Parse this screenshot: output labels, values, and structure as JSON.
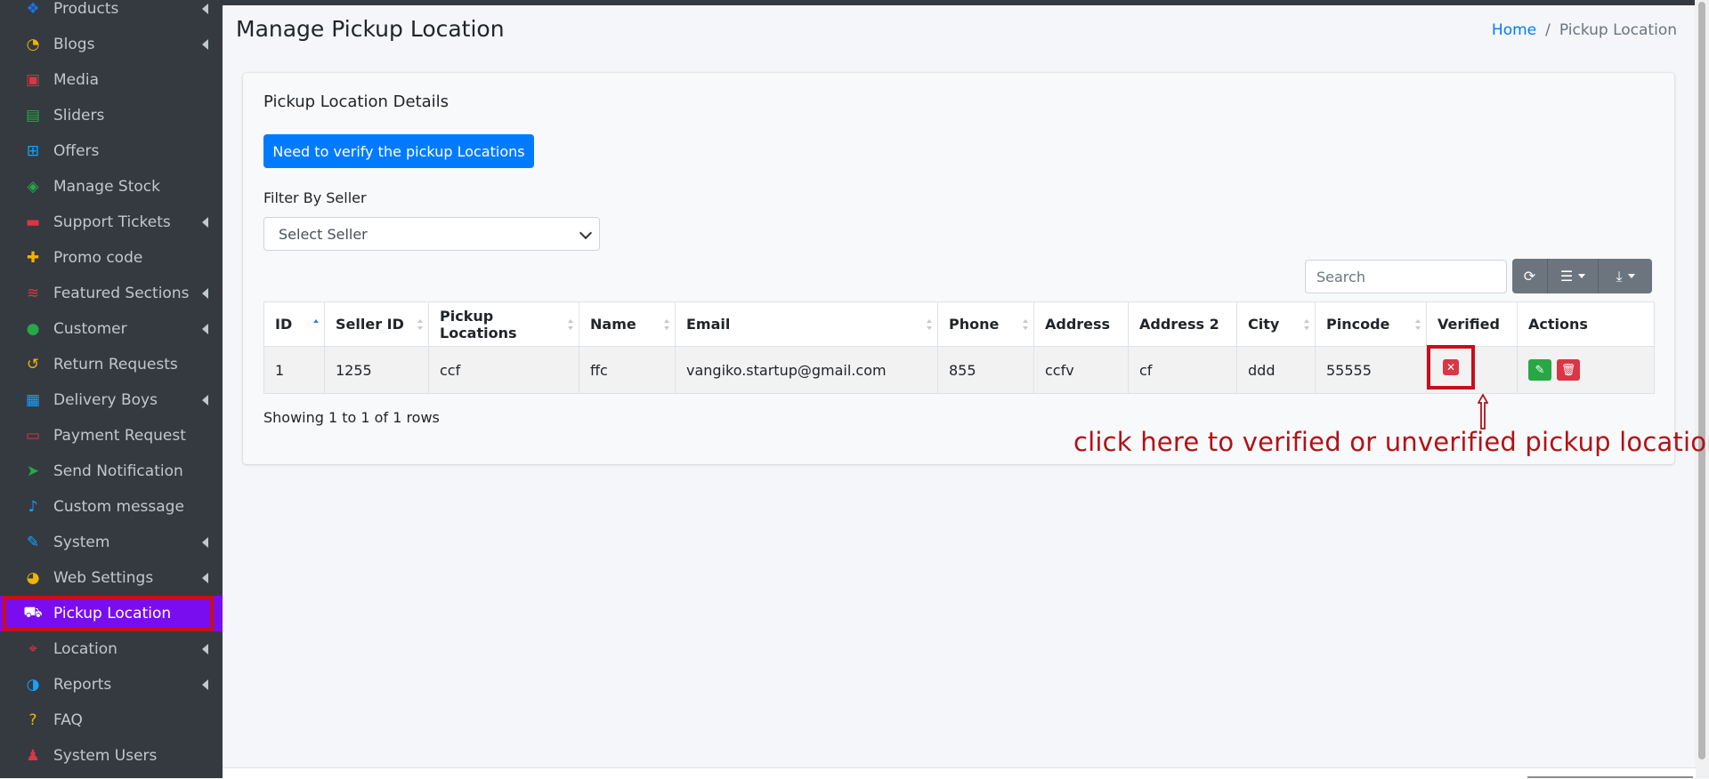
{
  "sidebar": {
    "items": [
      {
        "label": "Products",
        "icon": "cubes-icon",
        "glyph": "❖",
        "color": "#1a73e8",
        "arrow": true
      },
      {
        "label": "Blogs",
        "icon": "blog-icon",
        "glyph": "◔",
        "color": "#f0b400",
        "arrow": true
      },
      {
        "label": "Media",
        "icon": "media-icon",
        "glyph": "▣",
        "color": "#dc3545",
        "arrow": false
      },
      {
        "label": "Sliders",
        "icon": "sliders-icon",
        "glyph": "▤",
        "color": "#28a745",
        "arrow": false
      },
      {
        "label": "Offers",
        "icon": "gift-icon",
        "glyph": "⊞",
        "color": "#17a2ff",
        "arrow": false
      },
      {
        "label": "Manage Stock",
        "icon": "box-icon",
        "glyph": "◈",
        "color": "#28a745",
        "arrow": false
      },
      {
        "label": "Support Tickets",
        "icon": "ticket-icon",
        "glyph": "▬",
        "color": "#dc3545",
        "arrow": true
      },
      {
        "label": "Promo code",
        "icon": "puzzle-icon",
        "glyph": "✚",
        "color": "#f0b400",
        "arrow": false
      },
      {
        "label": "Featured Sections",
        "icon": "layers-icon",
        "glyph": "≋",
        "color": "#dc3545",
        "arrow": true
      },
      {
        "label": "Customer",
        "icon": "user-icon",
        "glyph": "●",
        "color": "#28a745",
        "arrow": true
      },
      {
        "label": "Return Requests",
        "icon": "undo-icon",
        "glyph": "↺",
        "color": "#f0b400",
        "arrow": false
      },
      {
        "label": "Delivery Boys",
        "icon": "id-badge-icon",
        "glyph": "▦",
        "color": "#17a2ff",
        "arrow": true
      },
      {
        "label": "Payment Request",
        "icon": "money-icon",
        "glyph": "▭",
        "color": "#dc3545",
        "arrow": false
      },
      {
        "label": "Send Notification",
        "icon": "paper-plane-icon",
        "glyph": "➤",
        "color": "#28a745",
        "arrow": false
      },
      {
        "label": "Custom message",
        "icon": "bell-icon",
        "glyph": "♪",
        "color": "#17a2ff",
        "arrow": false
      },
      {
        "label": "System",
        "icon": "wrench-icon",
        "glyph": "✎",
        "color": "#17a2ff",
        "arrow": true
      },
      {
        "label": "Web Settings",
        "icon": "globe-icon",
        "glyph": "◕",
        "color": "#f0b400",
        "arrow": true
      },
      {
        "label": "Pickup Location",
        "icon": "truck-icon",
        "glyph": "⛟",
        "color": "#ffffff",
        "arrow": false,
        "active": true
      },
      {
        "label": "Location",
        "icon": "map-icon",
        "glyph": "⌖",
        "color": "#dc3545",
        "arrow": true
      },
      {
        "label": "Reports",
        "icon": "pie-chart-icon",
        "glyph": "◑",
        "color": "#17a2ff",
        "arrow": true
      },
      {
        "label": "FAQ",
        "icon": "question-icon",
        "glyph": "?",
        "color": "#f0b400",
        "arrow": false
      },
      {
        "label": "System Users",
        "icon": "user-tie-icon",
        "glyph": "♟",
        "color": "#dc3545",
        "arrow": false
      }
    ]
  },
  "header": {
    "title": "Manage Pickup Location",
    "breadcrumb_home": "Home",
    "breadcrumb_sep": "/",
    "breadcrumb_current": "Pickup Location"
  },
  "card": {
    "title": "Pickup Location Details",
    "verify_button": "Need to verify the pickup Locations",
    "filter_label": "Filter By Seller",
    "seller_select_value": "Select Seller",
    "search_placeholder": "Search"
  },
  "table": {
    "columns": [
      "ID",
      "Seller ID",
      "Pickup Locations",
      "Name",
      "Email",
      "Phone",
      "Address",
      "Address 2",
      "City",
      "Pincode",
      "Verified",
      "Actions"
    ],
    "rows": [
      {
        "id": "1",
        "seller_id": "1255",
        "pickup_location": "ccf",
        "name": "ffc",
        "email": "vangiko.startup@gmail.com",
        "phone": "855",
        "address": "ccfv",
        "address2": "cf",
        "city": "ddd",
        "pincode": "55555"
      }
    ],
    "showing": "Showing 1 to 1 of 1 rows"
  },
  "annotation": {
    "text": "click here to verified or unverified pickup location",
    "color": "#b01217"
  }
}
